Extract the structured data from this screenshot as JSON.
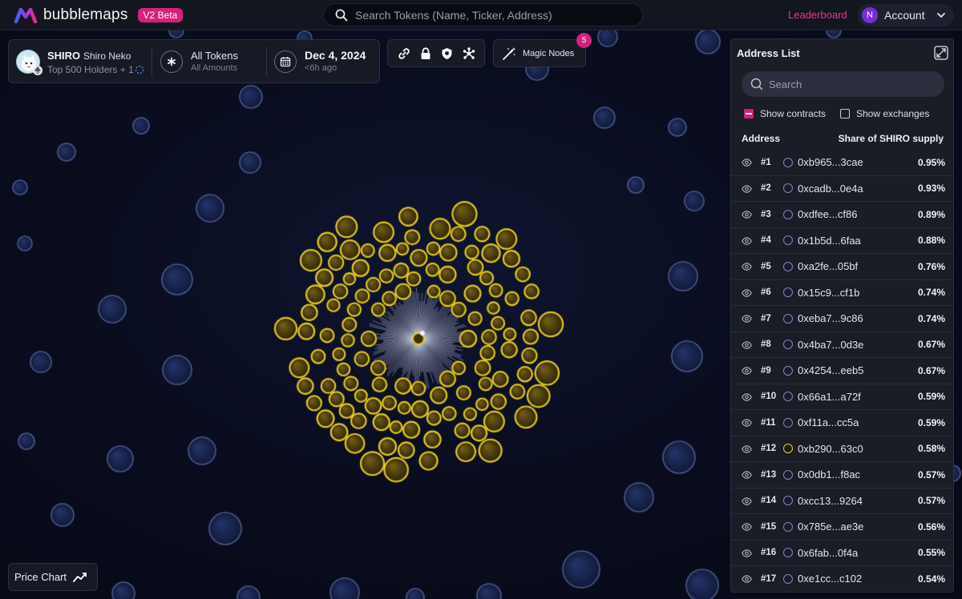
{
  "app": {
    "brand": "bubblemaps",
    "badge": "V2 Beta",
    "search_placeholder": "Search Tokens (Name, Ticker, Address)",
    "leaderboard": "Leaderboard",
    "account_initial": "N",
    "account": "Account"
  },
  "token": {
    "symbol": "SHIRO",
    "name": "Shiro Neko",
    "holders": "Top 500 Holders + 1",
    "tokens_filter": "All Tokens",
    "amounts_filter": "All Amounts",
    "date": "Dec 4, 2024",
    "date_ago": "<6h ago"
  },
  "toolbar": {
    "icons": [
      "link-icon",
      "lock-icon",
      "shield-icon",
      "network-icon"
    ],
    "magic_nodes": "Magic Nodes",
    "magic_count": "5"
  },
  "price_chart": "Price Chart",
  "panel": {
    "title": "Address List",
    "search_placeholder": "Search",
    "show_contracts": "Show contracts",
    "show_contracts_checked": true,
    "show_exchanges": "Show exchanges",
    "show_exchanges_checked": false,
    "col_address": "Address",
    "col_share": "Share of SHIRO supply",
    "rows": [
      {
        "rank": "#1",
        "address": "0xb965...3cae",
        "share": "0.95%",
        "highlight": false
      },
      {
        "rank": "#2",
        "address": "0xcadb...0e4a",
        "share": "0.93%",
        "highlight": false
      },
      {
        "rank": "#3",
        "address": "0xdfee...cf86",
        "share": "0.89%",
        "highlight": false
      },
      {
        "rank": "#4",
        "address": "0x1b5d...6faa",
        "share": "0.88%",
        "highlight": false
      },
      {
        "rank": "#5",
        "address": "0xa2fe...05bf",
        "share": "0.76%",
        "highlight": false
      },
      {
        "rank": "#6",
        "address": "0x15c9...cf1b",
        "share": "0.74%",
        "highlight": false
      },
      {
        "rank": "#7",
        "address": "0xeba7...9c86",
        "share": "0.74%",
        "highlight": false
      },
      {
        "rank": "#8",
        "address": "0x4ba7...0d3e",
        "share": "0.67%",
        "highlight": false
      },
      {
        "rank": "#9",
        "address": "0x4254...eeb5",
        "share": "0.67%",
        "highlight": false
      },
      {
        "rank": "#10",
        "address": "0x66a1...a72f",
        "share": "0.59%",
        "highlight": false
      },
      {
        "rank": "#11",
        "address": "0xf11a...cc5a",
        "share": "0.59%",
        "highlight": false
      },
      {
        "rank": "#12",
        "address": "0xb290...63c0",
        "share": "0.58%",
        "highlight": true
      },
      {
        "rank": "#13",
        "address": "0x0db1...f8ac",
        "share": "0.57%",
        "highlight": false
      },
      {
        "rank": "#14",
        "address": "0xcc13...9264",
        "share": "0.57%",
        "highlight": false
      },
      {
        "rank": "#15",
        "address": "0x785e...ae3e",
        "share": "0.56%",
        "highlight": false
      },
      {
        "rank": "#16",
        "address": "0x6fab...0f4a",
        "share": "0.55%",
        "highlight": false
      },
      {
        "rank": "#17",
        "address": "0xe1cc...c102",
        "share": "0.54%",
        "highlight": false
      }
    ]
  },
  "colors": {
    "accent": "#d5217d",
    "highlight_bubble": "#e8cc1c",
    "holder_bubble": "#1a2550"
  }
}
